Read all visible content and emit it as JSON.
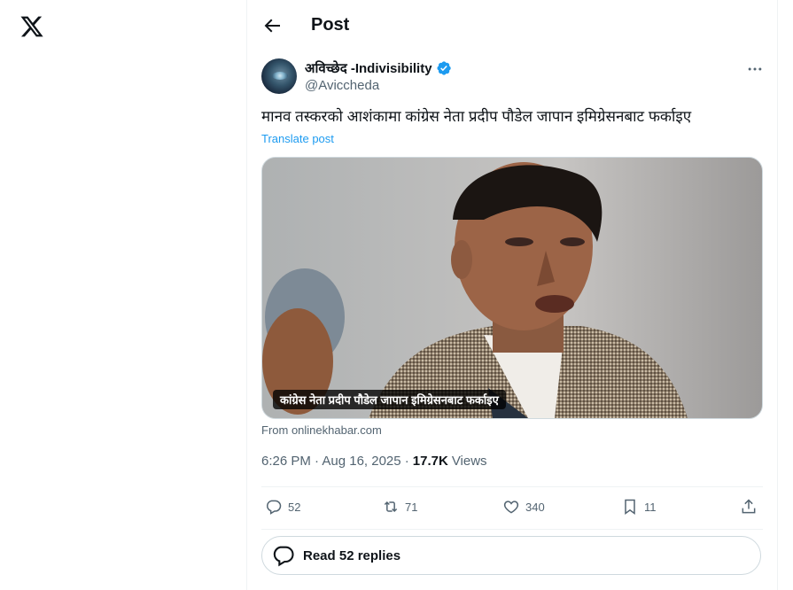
{
  "header": {
    "title": "Post"
  },
  "post": {
    "author_name": "अविच्छेद -Indivisibility",
    "author_handle": "@Aviccheda",
    "text": "मानव तस्करको आशंकामा कांग्रेस नेता प्रदीप पौडेल जापान इमिग्रेसनबाट फर्काइए",
    "translate_label": "Translate post",
    "media_caption": "कांग्रेस नेता प्रदीप पौडेल जापान इमिग्रेसनबाट फर्काइए",
    "source": "From onlinekhabar.com",
    "time": "6:26 PM · Aug 16, 2025 ·",
    "views_count": "17.7K",
    "views_label": "Views"
  },
  "actions": {
    "replies": "52",
    "reposts": "71",
    "likes": "340",
    "bookmarks": "11"
  },
  "read_replies_label": "Read 52 replies",
  "colors": {
    "accent": "#1d9bf0",
    "text": "#0f1419",
    "muted": "#536471",
    "border": "#cfd9de"
  },
  "icons": [
    "x-logo-icon",
    "back-arrow-icon",
    "verified-badge-icon",
    "more-icon",
    "reply-icon",
    "repost-icon",
    "like-icon",
    "bookmark-icon",
    "share-icon",
    "replies-bubble-icon"
  ]
}
